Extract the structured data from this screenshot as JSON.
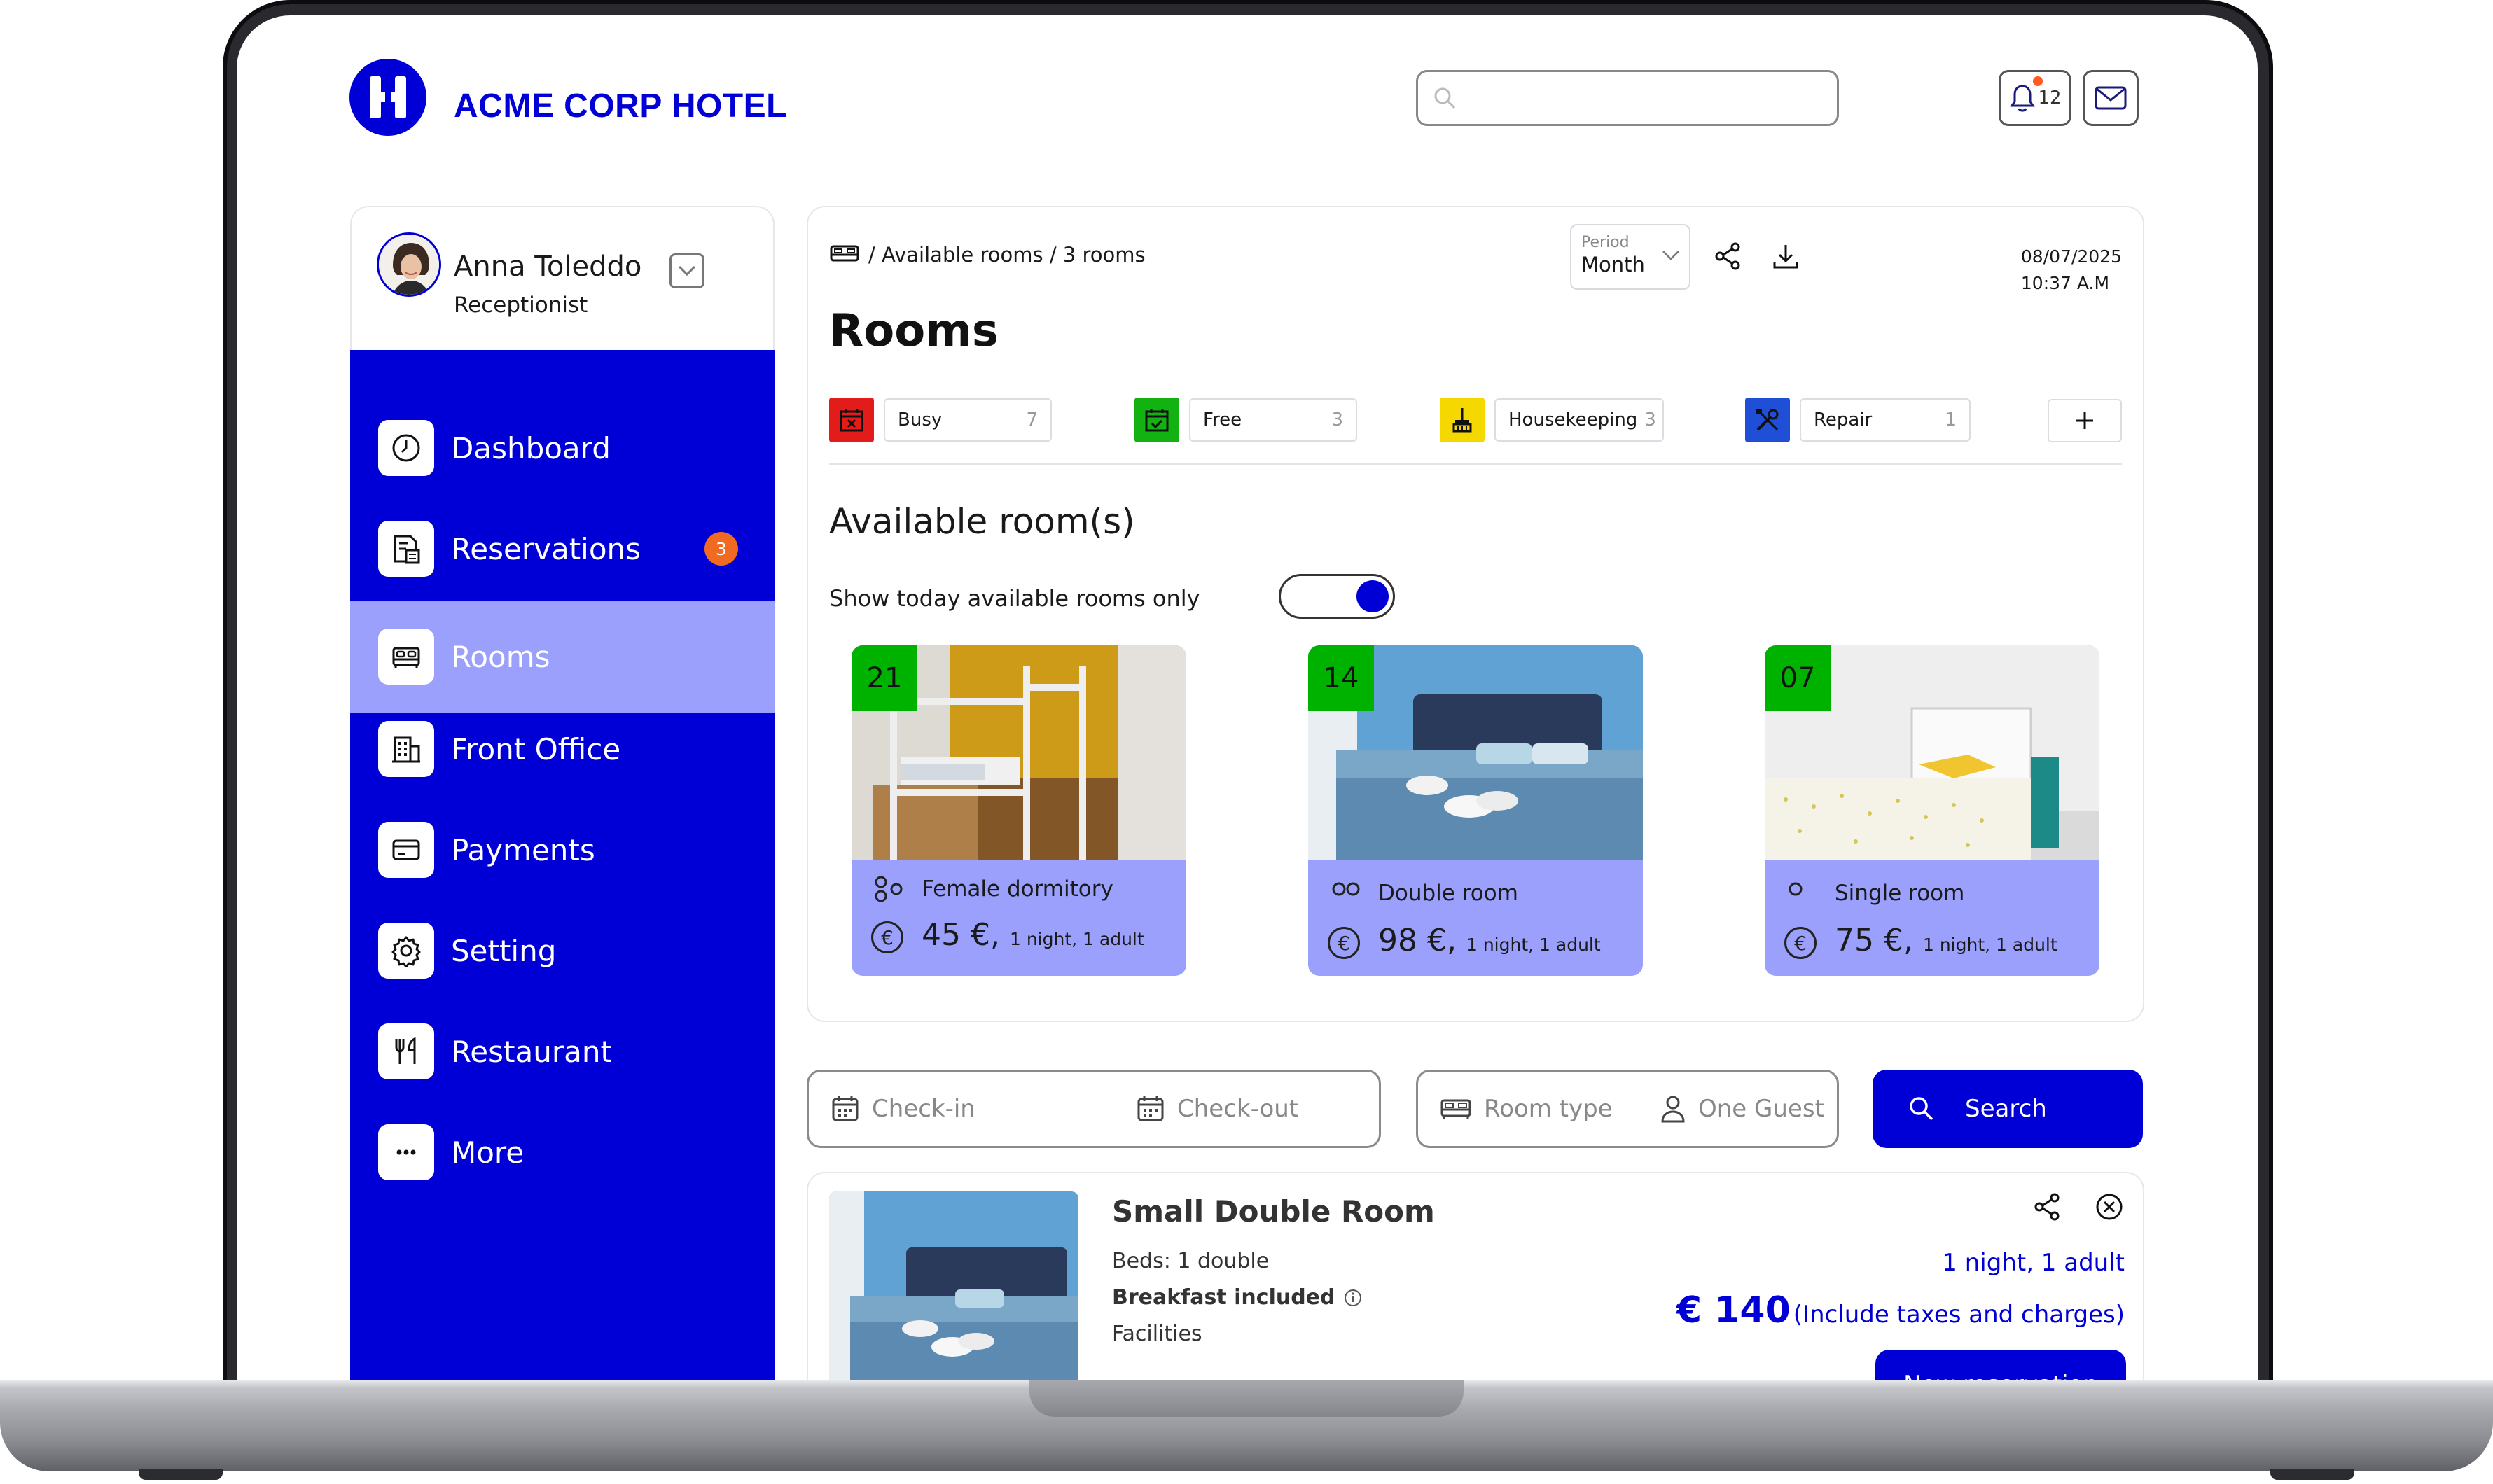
{
  "brand": {
    "name": "ACME CORP HOTEL"
  },
  "header": {
    "notification_count": "12",
    "search_placeholder": ""
  },
  "user": {
    "name": "Anna Toleddo",
    "role": "Receptionist"
  },
  "sidebar": {
    "items": [
      {
        "label": "Dashboard",
        "icon": "clock-icon"
      },
      {
        "label": "Reservations",
        "icon": "document-icon",
        "badge": "3"
      },
      {
        "label": "Rooms",
        "icon": "bed-icon",
        "active": true
      },
      {
        "label": "Front Office",
        "icon": "building-icon"
      },
      {
        "label": "Payments",
        "icon": "card-icon"
      },
      {
        "label": "Setting",
        "icon": "gear-icon"
      },
      {
        "label": "Restaurant",
        "icon": "cutlery-icon"
      },
      {
        "label": "More",
        "icon": "ellipsis-icon"
      }
    ]
  },
  "panel": {
    "breadcrumb": "/ Available rooms / 3 rooms",
    "period_label": "Period",
    "period_value": "Month",
    "date": "08/07/2025",
    "time": "10:37 A.M",
    "title": "Rooms"
  },
  "statuses": [
    {
      "label": "Busy",
      "count": "7",
      "color": "#e21b1b",
      "icon": "calendar-x-icon"
    },
    {
      "label": "Free",
      "count": "3",
      "color": "#12b212",
      "icon": "calendar-check-icon"
    },
    {
      "label": "Housekeeping",
      "count": "3",
      "color": "#f4d800",
      "icon": "broom-icon"
    },
    {
      "label": "Repair",
      "count": "1",
      "color": "#1f4fd6",
      "icon": "tools-icon"
    }
  ],
  "available": {
    "title": "Available room(s)",
    "toggle_label": "Show today available rooms only",
    "toggle_on": true
  },
  "room_cards": [
    {
      "number": "21",
      "type": "Female dormitory",
      "price": "45 €,",
      "note": "1 night, 1 adult"
    },
    {
      "number": "14",
      "type": "Double room",
      "price": "98 €,",
      "note": "1 night, 1 adult"
    },
    {
      "number": "07",
      "type": "Single room",
      "price": "75 €,",
      "note": "1 night, 1 adult"
    }
  ],
  "search": {
    "checkin": "Check-in",
    "checkout": "Check-out",
    "room_type": "Room type",
    "guests": "One Guest",
    "button": "Search"
  },
  "result": {
    "title": "Small Double Room",
    "beds": "Beds: 1 double",
    "breakfast": "Breakfast included",
    "facilities": "Facilities",
    "stay": "1 night, 1 adult",
    "price": "€ 140",
    "price_note": "(Include taxes and charges)",
    "button": "New reservation"
  },
  "colors": {
    "primary": "#0000d6",
    "active_nav": "#9aa0fb",
    "badge": "#f06a22"
  }
}
